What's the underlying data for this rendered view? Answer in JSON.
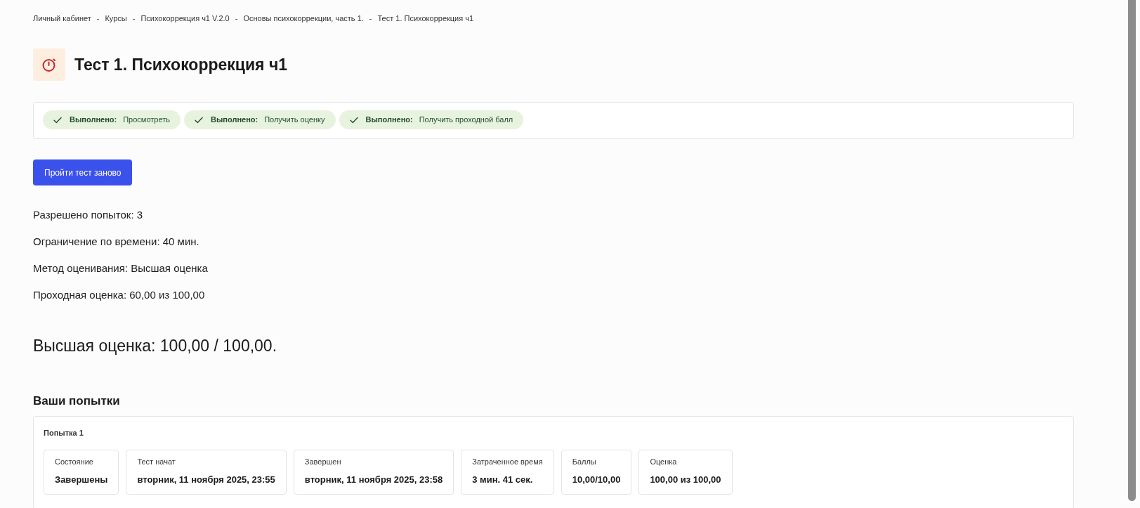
{
  "breadcrumbs": [
    {
      "label": "Личный кабинет"
    },
    {
      "separator": "-",
      "label": "Курсы"
    },
    {
      "separator": "-",
      "label": "Психокоррекция ч1 V.2.0"
    },
    {
      "separator": "-",
      "label": "Основы психокоррекции, часть 1."
    },
    {
      "separator": "-",
      "label": "Тест 1. Психокоррекция ч1"
    }
  ],
  "page": {
    "title": "Тест 1. Психокоррекция ч1"
  },
  "completion": [
    {
      "status": "Выполнено:",
      "label": "Просмотреть",
      "done": true
    },
    {
      "status": "Выполнено:",
      "label": "Получить оценку",
      "done": true
    },
    {
      "status": "Выполнено:",
      "label": "Получить проходной балл",
      "done": true
    }
  ],
  "retake_button": "Пройти тест заново",
  "info": [
    "Разрешено попыток: 3",
    "Ограничение по времени: 40 мин.",
    "Метод оценивания: Высшая оценка",
    "Проходная оценка: 60,00 из 100,00"
  ],
  "highest_grade": "Высшая оценка: 100,00 / 100,00.",
  "attempts": {
    "heading": "Ваши попытки",
    "items": [
      {
        "title": "Попытка 1",
        "fields": [
          {
            "label": "Состояние",
            "value": "Завершены"
          },
          {
            "label": "Тест начат",
            "value": "вторник, 11 ноября 2025, 23:55"
          },
          {
            "label": "Завершен",
            "value": "вторник, 11 ноября 2025, 23:58"
          },
          {
            "label": "Затраченное время",
            "value": "3 мин. 41 сек."
          },
          {
            "label": "Баллы",
            "value": "10,00/10,00"
          },
          {
            "label": "Оценка",
            "value": "100,00 из 100,00"
          }
        ]
      }
    ]
  }
}
